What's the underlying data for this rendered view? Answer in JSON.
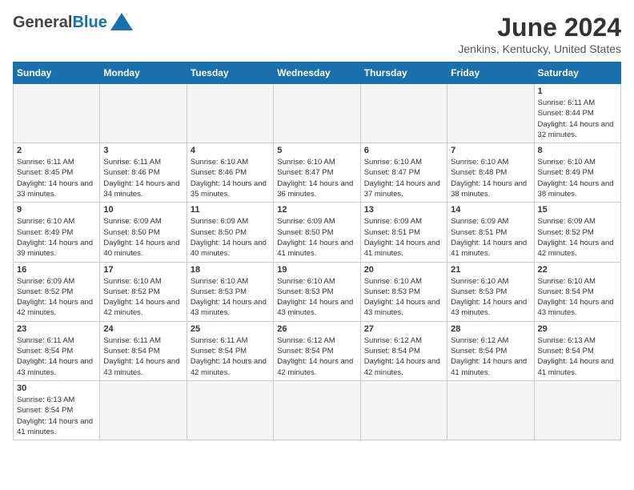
{
  "header": {
    "month_title": "June 2024",
    "location": "Jenkins, Kentucky, United States",
    "logo_general": "General",
    "logo_blue": "Blue",
    "logo_tagline": ""
  },
  "weekdays": [
    "Sunday",
    "Monday",
    "Tuesday",
    "Wednesday",
    "Thursday",
    "Friday",
    "Saturday"
  ],
  "weeks": [
    [
      {
        "day": "",
        "info": ""
      },
      {
        "day": "",
        "info": ""
      },
      {
        "day": "",
        "info": ""
      },
      {
        "day": "",
        "info": ""
      },
      {
        "day": "",
        "info": ""
      },
      {
        "day": "",
        "info": ""
      },
      {
        "day": "1",
        "info": "Sunrise: 6:11 AM\nSunset: 8:44 PM\nDaylight: 14 hours\nand 32 minutes."
      }
    ],
    [
      {
        "day": "2",
        "info": "Sunrise: 6:11 AM\nSunset: 8:45 PM\nDaylight: 14 hours\nand 33 minutes."
      },
      {
        "day": "3",
        "info": "Sunrise: 6:11 AM\nSunset: 8:46 PM\nDaylight: 14 hours\nand 34 minutes."
      },
      {
        "day": "4",
        "info": "Sunrise: 6:10 AM\nSunset: 8:46 PM\nDaylight: 14 hours\nand 35 minutes."
      },
      {
        "day": "5",
        "info": "Sunrise: 6:10 AM\nSunset: 8:47 PM\nDaylight: 14 hours\nand 36 minutes."
      },
      {
        "day": "6",
        "info": "Sunrise: 6:10 AM\nSunset: 8:47 PM\nDaylight: 14 hours\nand 37 minutes."
      },
      {
        "day": "7",
        "info": "Sunrise: 6:10 AM\nSunset: 8:48 PM\nDaylight: 14 hours\nand 38 minutes."
      },
      {
        "day": "8",
        "info": "Sunrise: 6:10 AM\nSunset: 8:49 PM\nDaylight: 14 hours\nand 38 minutes."
      }
    ],
    [
      {
        "day": "9",
        "info": "Sunrise: 6:10 AM\nSunset: 8:49 PM\nDaylight: 14 hours\nand 39 minutes."
      },
      {
        "day": "10",
        "info": "Sunrise: 6:09 AM\nSunset: 8:50 PM\nDaylight: 14 hours\nand 40 minutes."
      },
      {
        "day": "11",
        "info": "Sunrise: 6:09 AM\nSunset: 8:50 PM\nDaylight: 14 hours\nand 40 minutes."
      },
      {
        "day": "12",
        "info": "Sunrise: 6:09 AM\nSunset: 8:50 PM\nDaylight: 14 hours\nand 41 minutes."
      },
      {
        "day": "13",
        "info": "Sunrise: 6:09 AM\nSunset: 8:51 PM\nDaylight: 14 hours\nand 41 minutes."
      },
      {
        "day": "14",
        "info": "Sunrise: 6:09 AM\nSunset: 8:51 PM\nDaylight: 14 hours\nand 41 minutes."
      },
      {
        "day": "15",
        "info": "Sunrise: 6:09 AM\nSunset: 8:52 PM\nDaylight: 14 hours\nand 42 minutes."
      }
    ],
    [
      {
        "day": "16",
        "info": "Sunrise: 6:09 AM\nSunset: 8:52 PM\nDaylight: 14 hours\nand 42 minutes."
      },
      {
        "day": "17",
        "info": "Sunrise: 6:10 AM\nSunset: 8:52 PM\nDaylight: 14 hours\nand 42 minutes."
      },
      {
        "day": "18",
        "info": "Sunrise: 6:10 AM\nSunset: 8:53 PM\nDaylight: 14 hours\nand 43 minutes."
      },
      {
        "day": "19",
        "info": "Sunrise: 6:10 AM\nSunset: 8:53 PM\nDaylight: 14 hours\nand 43 minutes."
      },
      {
        "day": "20",
        "info": "Sunrise: 6:10 AM\nSunset: 8:53 PM\nDaylight: 14 hours\nand 43 minutes."
      },
      {
        "day": "21",
        "info": "Sunrise: 6:10 AM\nSunset: 8:53 PM\nDaylight: 14 hours\nand 43 minutes."
      },
      {
        "day": "22",
        "info": "Sunrise: 6:10 AM\nSunset: 8:54 PM\nDaylight: 14 hours\nand 43 minutes."
      }
    ],
    [
      {
        "day": "23",
        "info": "Sunrise: 6:11 AM\nSunset: 8:54 PM\nDaylight: 14 hours\nand 43 minutes."
      },
      {
        "day": "24",
        "info": "Sunrise: 6:11 AM\nSunset: 8:54 PM\nDaylight: 14 hours\nand 43 minutes."
      },
      {
        "day": "25",
        "info": "Sunrise: 6:11 AM\nSunset: 8:54 PM\nDaylight: 14 hours\nand 42 minutes."
      },
      {
        "day": "26",
        "info": "Sunrise: 6:12 AM\nSunset: 8:54 PM\nDaylight: 14 hours\nand 42 minutes."
      },
      {
        "day": "27",
        "info": "Sunrise: 6:12 AM\nSunset: 8:54 PM\nDaylight: 14 hours\nand 42 minutes."
      },
      {
        "day": "28",
        "info": "Sunrise: 6:12 AM\nSunset: 8:54 PM\nDaylight: 14 hours\nand 41 minutes."
      },
      {
        "day": "29",
        "info": "Sunrise: 6:13 AM\nSunset: 8:54 PM\nDaylight: 14 hours\nand 41 minutes."
      }
    ],
    [
      {
        "day": "30",
        "info": "Sunrise: 6:13 AM\nSunset: 8:54 PM\nDaylight: 14 hours\nand 41 minutes."
      },
      {
        "day": "",
        "info": ""
      },
      {
        "day": "",
        "info": ""
      },
      {
        "day": "",
        "info": ""
      },
      {
        "day": "",
        "info": ""
      },
      {
        "day": "",
        "info": ""
      },
      {
        "day": "",
        "info": ""
      }
    ]
  ]
}
